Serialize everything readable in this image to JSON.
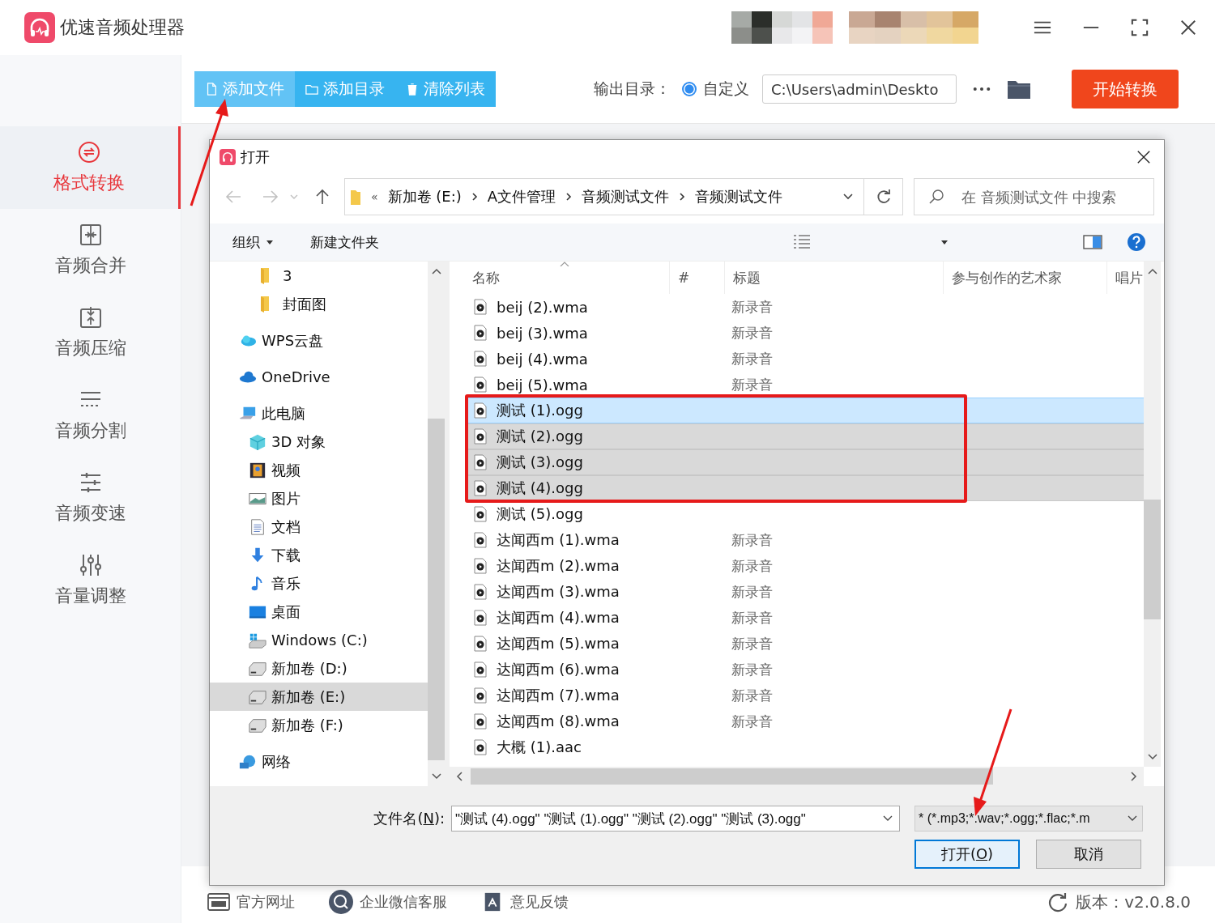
{
  "app": {
    "title": "优速音频处理器"
  },
  "sidebar": {
    "items": [
      {
        "label": "格式转换",
        "selected": true
      },
      {
        "label": "音频合并",
        "selected": false
      },
      {
        "label": "音频压缩",
        "selected": false
      },
      {
        "label": "音频分割",
        "selected": false
      },
      {
        "label": "音频变速",
        "selected": false
      },
      {
        "label": "音量调整",
        "selected": false
      }
    ]
  },
  "toolbar": {
    "buttons": [
      {
        "label": "添加文件",
        "selected": true
      },
      {
        "label": "添加目录",
        "selected": false
      },
      {
        "label": "清除列表",
        "selected": false
      }
    ],
    "output_label": "输出目录：",
    "custom": {
      "label": "自定义",
      "selected": true
    },
    "output_path": "C:\\Users\\admin\\Deskto",
    "start_button": "开始转换"
  },
  "dialog": {
    "title": "打开",
    "address": {
      "overflow": "«",
      "crumbs": [
        "新加卷 (E:)",
        "A文件管理",
        "音频测试文件",
        "音频测试文件"
      ]
    },
    "search": {
      "placeholder": "在 音频测试文件 中搜索"
    },
    "commands": {
      "organize": "组织",
      "new_folder": "新建文件夹"
    },
    "scrolled_folders": [
      {
        "label": "3",
        "kind": "folder",
        "selected": false
      },
      {
        "label": "封面图",
        "kind": "folder",
        "selected": false
      }
    ],
    "nav_tree": [
      {
        "label": "WPS云盘",
        "kind": "cloud",
        "selected": false
      },
      {
        "label": "OneDrive",
        "kind": "onedrive",
        "selected": false
      },
      {
        "label": "此电脑",
        "kind": "pc",
        "selected": false,
        "children": [
          {
            "label": "3D 对象",
            "kind": "cube",
            "selected": false
          },
          {
            "label": "视频",
            "kind": "video",
            "selected": false
          },
          {
            "label": "图片",
            "kind": "picture",
            "selected": false
          },
          {
            "label": "文档",
            "kind": "document",
            "selected": false
          },
          {
            "label": "下载",
            "kind": "download",
            "selected": false
          },
          {
            "label": "音乐",
            "kind": "music",
            "selected": false
          },
          {
            "label": "桌面",
            "kind": "desktop",
            "selected": false
          },
          {
            "label": "Windows (C:)",
            "kind": "windrive",
            "selected": false
          },
          {
            "label": "新加卷 (D:)",
            "kind": "drive",
            "selected": false
          },
          {
            "label": "新加卷 (E:)",
            "kind": "drive",
            "selected": true
          },
          {
            "label": "新加卷 (F:)",
            "kind": "drive",
            "selected": false
          }
        ]
      },
      {
        "label": "网络",
        "kind": "network",
        "selected": false
      }
    ],
    "files": {
      "columns": [
        "名称",
        "#",
        "标题",
        "参与创作的艺术家",
        "唱片"
      ],
      "rows": [
        {
          "name": "beij (2).wma",
          "title": "新录音",
          "selected": false,
          "focused": false
        },
        {
          "name": "beij (3).wma",
          "title": "新录音",
          "selected": false,
          "focused": false
        },
        {
          "name": "beij (4).wma",
          "title": "新录音",
          "selected": false,
          "focused": false
        },
        {
          "name": "beij (5).wma",
          "title": "新录音",
          "selected": false,
          "focused": false
        },
        {
          "name": "测试 (1).ogg",
          "selected": true,
          "focused": true
        },
        {
          "name": "测试 (2).ogg",
          "selected": true,
          "focused": false
        },
        {
          "name": "测试 (3).ogg",
          "selected": true,
          "focused": false
        },
        {
          "name": "测试 (4).ogg",
          "selected": true,
          "focused": false
        },
        {
          "name": "测试 (5).ogg",
          "selected": false,
          "focused": false
        },
        {
          "name": "达闻西m (1).wma",
          "title": "新录音",
          "selected": false,
          "focused": false
        },
        {
          "name": "达闻西m (2).wma",
          "title": "新录音",
          "selected": false,
          "focused": false
        },
        {
          "name": "达闻西m (3).wma",
          "title": "新录音",
          "selected": false,
          "focused": false
        },
        {
          "name": "达闻西m (4).wma",
          "title": "新录音",
          "selected": false,
          "focused": false
        },
        {
          "name": "达闻西m (5).wma",
          "title": "新录音",
          "selected": false,
          "focused": false
        },
        {
          "name": "达闻西m (6).wma",
          "title": "新录音",
          "selected": false,
          "focused": false
        },
        {
          "name": "达闻西m (7).wma",
          "title": "新录音",
          "selected": false,
          "focused": false
        },
        {
          "name": "达闻西m (8).wma",
          "title": "新录音",
          "selected": false,
          "focused": false
        },
        {
          "name": "大概 (1).aac",
          "selected": false,
          "focused": false
        }
      ]
    },
    "filename": {
      "label_before": "文件名(",
      "access_key": "N",
      "label_after": "):",
      "value": "\"测试 (4).ogg\" \"测试 (1).ogg\" \"测试 (2).ogg\" \"测试 (3).ogg\""
    },
    "filter": "* (*.mp3;*.wav;*.ogg;*.flac;*.m",
    "open_button": {
      "label_before": "打开(",
      "access_key": "O",
      "label_after": ")"
    },
    "cancel_button": "取消"
  },
  "footer": {
    "links": [
      "官方网址",
      "企业微信客服",
      "意见反馈"
    ],
    "version": "版本：v2.0.8.0"
  }
}
